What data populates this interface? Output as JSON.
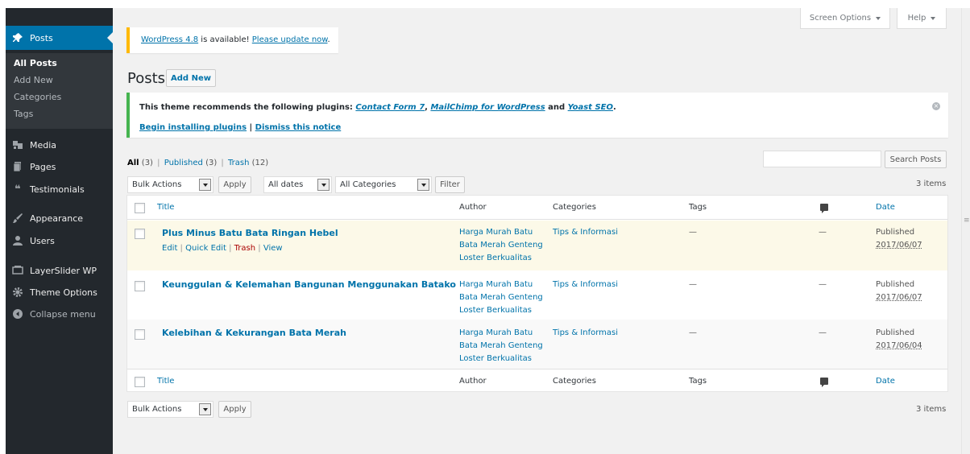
{
  "colors": {
    "sidebar": "#23282d",
    "submenu": "#32373c",
    "accent": "#0073aa",
    "bg": "#f1f1f1",
    "update_notice": "#ffb900",
    "plugin_notice": "#46b450",
    "highlight_row": "#fcf9e8",
    "trash": "#a00"
  },
  "sidebar": {
    "posts": {
      "label": "Posts",
      "icon": "pushpin-icon"
    },
    "submenu": [
      "All Posts",
      "Add New",
      "Categories",
      "Tags"
    ],
    "items": [
      {
        "label": "Media",
        "icon": "media-icon"
      },
      {
        "label": "Pages",
        "icon": "pages-icon"
      },
      {
        "label": "Testimonials",
        "icon": "quote-icon"
      },
      {
        "label": "Appearance",
        "icon": "brush-icon"
      },
      {
        "label": "Users",
        "icon": "users-icon"
      },
      {
        "label": "LayerSlider WP",
        "icon": "slides-icon"
      },
      {
        "label": "Theme Options",
        "icon": "gear-icon"
      },
      {
        "label": "Collapse menu",
        "icon": "collapse-icon"
      }
    ]
  },
  "top": {
    "screen_options": "Screen Options",
    "help": "Help"
  },
  "update_notice": {
    "link1": "WordPress 4.8",
    "middle": " is available! ",
    "link2": "Please update now",
    "end": "."
  },
  "plugin_notice": {
    "intro": "This theme recommends the following plugins: ",
    "p1": "Contact Form 7",
    "sep1": ", ",
    "p2": "MailChimp for WordPress",
    "and": " and ",
    "p3": "Yoast SEO",
    "end": ".",
    "begin": "Begin installing plugins",
    "pipe": " | ",
    "dismiss": "Dismiss this notice"
  },
  "heading": {
    "title": "Posts",
    "add_new": "Add New"
  },
  "filters": {
    "all": "All",
    "all_count": "(3)",
    "published": "Published",
    "published_count": "(3)",
    "trash": "Trash",
    "trash_count": "(12)",
    "sep": "|",
    "bulk_actions": "Bulk Actions",
    "apply": "Apply",
    "all_dates": "All dates",
    "all_categories": "All Categories",
    "filter": "Filter",
    "items": "3 items",
    "search_button": "Search Posts",
    "search_value": ""
  },
  "table": {
    "columns": {
      "title": "Title",
      "author": "Author",
      "categories": "Categories",
      "tags": "Tags",
      "date": "Date"
    },
    "row_actions": {
      "edit": "Edit",
      "quick_edit": "Quick Edit",
      "trash": "Trash",
      "view": "View",
      "sep": " | "
    },
    "rows": [
      {
        "title": "Plus Minus Batu Bata Ringan Hebel",
        "author": [
          "Harga Murah Batu",
          "Bata Merah Genteng",
          "Loster Berkualitas"
        ],
        "category": "Tips & Informasi",
        "tags": "—",
        "comments": "—",
        "status": "Published",
        "date": "2017/06/07"
      },
      {
        "title": "Keunggulan & Kelemahan Bangunan Menggunakan Batako",
        "author": [
          "Harga Murah Batu",
          "Bata Merah Genteng",
          "Loster Berkualitas"
        ],
        "category": "Tips & Informasi",
        "tags": "—",
        "comments": "—",
        "status": "Published",
        "date": "2017/06/07"
      },
      {
        "title": "Kelebihan & Kekurangan Bata Merah",
        "author": [
          "Harga Murah Batu",
          "Bata Merah Genteng",
          "Loster Berkualitas"
        ],
        "category": "Tips & Informasi",
        "tags": "—",
        "comments": "—",
        "status": "Published",
        "date": "2017/06/04"
      }
    ]
  }
}
